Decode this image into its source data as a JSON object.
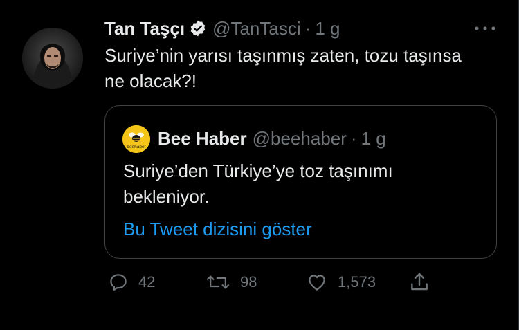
{
  "author": {
    "name": "Tan Taşçı",
    "handle": "@TanTasci",
    "separator": "·",
    "time": "1 g",
    "verified": true,
    "avatar_icon": "person-avatar"
  },
  "tweet": {
    "text": "Suriye’nin yarısı taşınmış zaten, tozu taşınsa ne olacak?!"
  },
  "quote": {
    "name": "Bee Haber",
    "handle": "@beehaber",
    "separator": "·",
    "time": "1 g",
    "avatar_label": "beehaber",
    "text": "Suriye’den Türkiye’ye toz taşınımı bekleniyor.",
    "thread_link": "Bu Tweet dizisini göster"
  },
  "actions": {
    "reply_count": "42",
    "retweet_count": "98",
    "like_count": "1,573"
  },
  "colors": {
    "background": "#000000",
    "text": "#e7e9ea",
    "muted": "#71767b",
    "link": "#1d9bf0",
    "border": "#3e4144",
    "bee_yellow": "#f5c518"
  }
}
